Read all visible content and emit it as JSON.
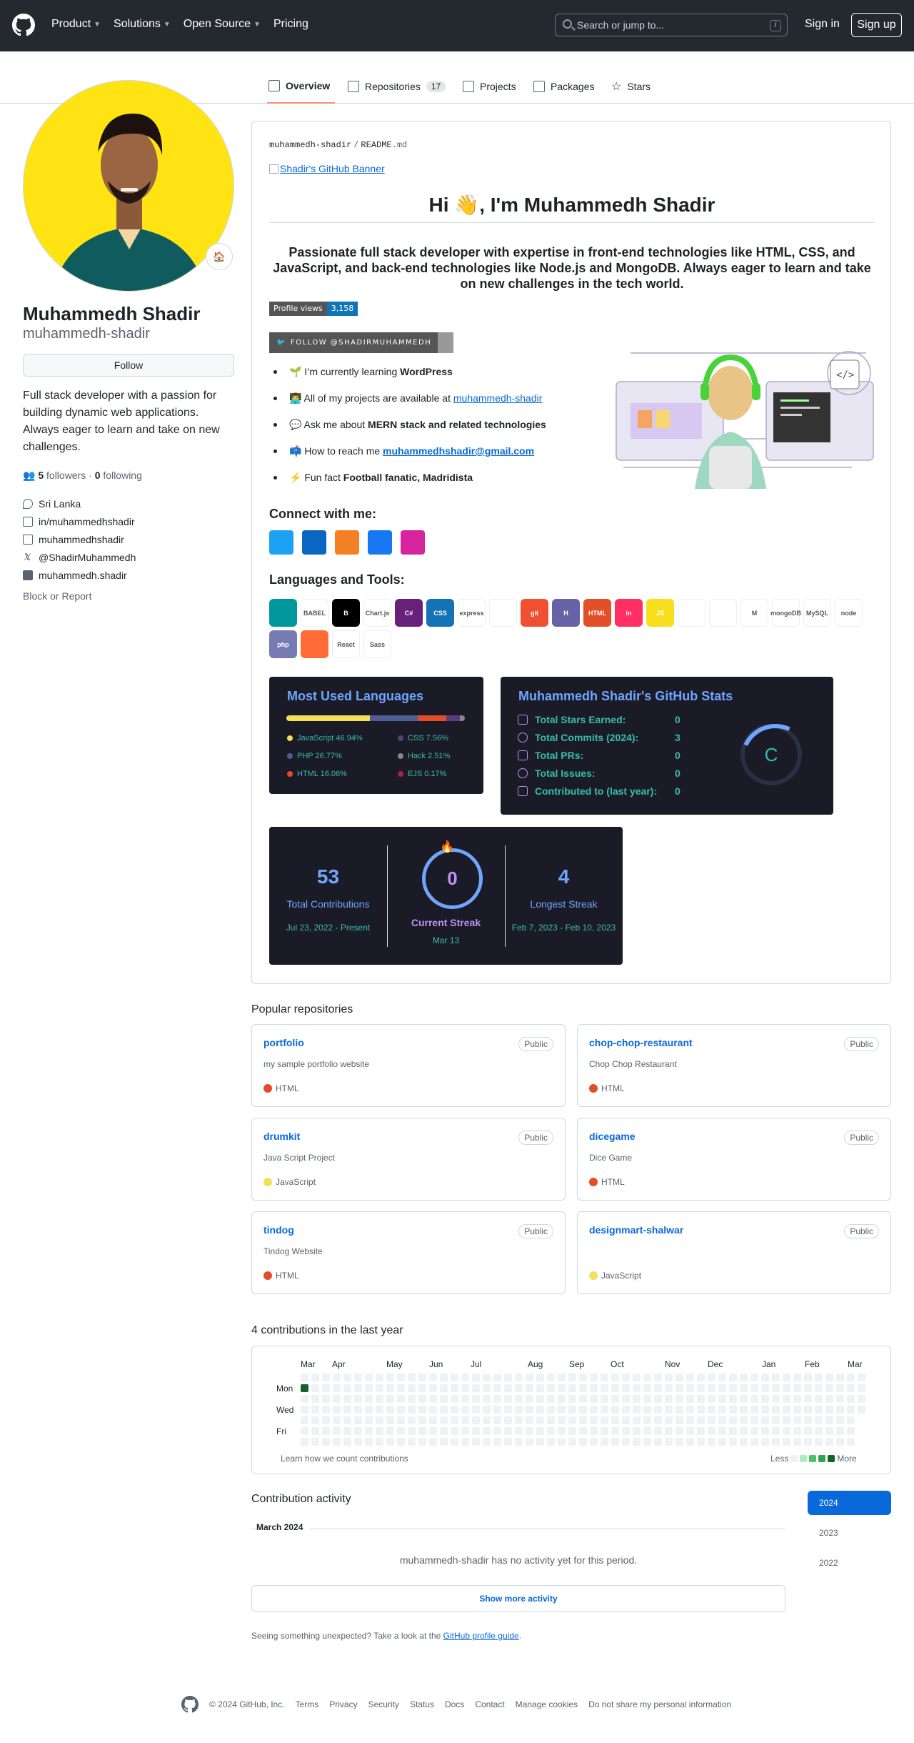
{
  "header": {
    "nav": [
      "Product",
      "Solutions",
      "Open Source",
      "Pricing"
    ],
    "search_placeholder": "Search or jump to...",
    "search_key": "/",
    "signin": "Sign in",
    "signup": "Sign up"
  },
  "tabs": [
    {
      "label": "Overview"
    },
    {
      "label": "Repositories",
      "count": "17"
    },
    {
      "label": "Projects"
    },
    {
      "label": "Packages"
    },
    {
      "label": "Stars"
    }
  ],
  "profile": {
    "name": "Muhammedh Shadir",
    "login": "muhammedh-shadir",
    "follow": "Follow",
    "bio": "Full stack developer with a passion for building dynamic web applications. Always eager to learn and take on new challenges.",
    "followers": "5",
    "followers_label": "followers",
    "following": "0",
    "following_label": "following",
    "sep": "·",
    "location": "Sri Lanka",
    "linkedin": "in/muhammedhshadir",
    "instagram": "muhammedhshadir",
    "x": "@ShadirMuhammedh",
    "facebook": "muhammedh.shadir",
    "block": "Block or Report"
  },
  "readme": {
    "path_user": "muhammedh-shadir",
    "path_sep": "/",
    "path_file": "README",
    "path_ext": ".md",
    "banner_alt": "Shadir's GitHub Banner",
    "hi": "Hi 👋, I'm Muhammedh Shadir",
    "tagline": "Passionate full stack developer with expertise in front-end technologies like HTML, CSS, and JavaScript, and back-end technologies like Node.js and MongoDB. Always eager to learn and take on new challenges in the tech world.",
    "views_label": "Profile views",
    "views_value": "3,158",
    "twitter_follow": "FOLLOW @SHADIRMUHAMMEDH",
    "bullets": [
      {
        "pre": "🌱 I’m currently learning ",
        "bold": "WordPress"
      },
      {
        "pre": "👨‍💻 All of my projects are available at ",
        "link": "muhammedh-shadir"
      },
      {
        "pre": "💬 Ask me about ",
        "bold": "MERN stack and related technologies"
      },
      {
        "pre": "📫 How to reach me ",
        "link": "muhammedhshadir@gmail.com"
      },
      {
        "pre": "⚡ Fun fact ",
        "bold": "Football fanatic, Madridista"
      }
    ],
    "connect": "Connect with me:",
    "tools_title": "Languages and Tools:",
    "tools": [
      {
        "t": "",
        "c": "#00979d"
      },
      {
        "t": "BABEL",
        "c": "#ffffff"
      },
      {
        "t": "B",
        "c": "#000000"
      },
      {
        "t": "Chart.js",
        "c": "#ffffff"
      },
      {
        "t": "C#",
        "c": "#68217a"
      },
      {
        "t": "CSS",
        "c": "#1572b6"
      },
      {
        "t": "express",
        "c": "#ffffff"
      },
      {
        "t": "",
        "c": "#ffffff"
      },
      {
        "t": "git",
        "c": "#f05032"
      },
      {
        "t": "H",
        "c": "#6762a6"
      },
      {
        "t": "HTML",
        "c": "#e34f26"
      },
      {
        "t": "in",
        "c": "#ff2e63"
      },
      {
        "t": "JS",
        "c": "#f7df1e"
      },
      {
        "t": "",
        "c": "#ffffff"
      },
      {
        "t": "",
        "c": "#ffffff"
      },
      {
        "t": "M",
        "c": "#ffffff"
      },
      {
        "t": "mongoDB",
        "c": "#ffffff"
      },
      {
        "t": "MySQL",
        "c": "#ffffff"
      },
      {
        "t": "node",
        "c": "#ffffff"
      },
      {
        "t": "php",
        "c": "#777bb4"
      },
      {
        "t": "",
        "c": "#ff6c37"
      },
      {
        "t": "React",
        "c": "#ffffff"
      },
      {
        "t": "Sass",
        "c": "#ffffff"
      }
    ]
  },
  "langs": {
    "title": "Most Used Languages",
    "items": [
      {
        "name": "JavaScript 46.94%",
        "pct": 46.94,
        "color": "#f1e05a"
      },
      {
        "name": "CSS 7.56%",
        "pct": 7.56,
        "color": "#563d7c"
      },
      {
        "name": "PHP 26.77%",
        "pct": 26.77,
        "color": "#4f5d95"
      },
      {
        "name": "Hack 2.51%",
        "pct": 2.51,
        "color": "#878787"
      },
      {
        "name": "HTML 16.06%",
        "pct": 16.06,
        "color": "#e34c26"
      },
      {
        "name": "EJS 0.17%",
        "pct": 0.17,
        "color": "#a91e50"
      }
    ]
  },
  "stats": {
    "title": "Muhammedh Shadir's GitHub Stats",
    "rows": [
      {
        "label": "Total Stars Earned:",
        "value": "0"
      },
      {
        "label": "Total Commits (2024):",
        "value": "3"
      },
      {
        "label": "Total PRs:",
        "value": "0"
      },
      {
        "label": "Total Issues:",
        "value": "0"
      },
      {
        "label": "Contributed to (last year):",
        "value": "0"
      }
    ],
    "rank": "C"
  },
  "streak": {
    "total": "53",
    "total_label": "Total Contributions",
    "total_range": "Jul 23, 2022 - Present",
    "current": "0",
    "current_label": "Current Streak",
    "current_date": "Mar 13",
    "longest": "4",
    "longest_label": "Longest Streak",
    "longest_range": "Feb 7, 2023 - Feb 10, 2023"
  },
  "popular_title": "Popular repositories",
  "repos": [
    {
      "name": "portfolio",
      "vis": "Public",
      "desc": "my sample portfolio website",
      "lang": "HTML",
      "color": "#e34c26"
    },
    {
      "name": "chop-chop-restaurant",
      "vis": "Public",
      "desc": "Chop Chop Restaurant",
      "lang": "HTML",
      "color": "#e34c26"
    },
    {
      "name": "drumkit",
      "vis": "Public",
      "desc": "Java Script Project",
      "lang": "JavaScript",
      "color": "#f1e05a"
    },
    {
      "name": "dicegame",
      "vis": "Public",
      "desc": "Dice Game",
      "lang": "HTML",
      "color": "#e34c26"
    },
    {
      "name": "tindog",
      "vis": "Public",
      "desc": "Tindog Website",
      "lang": "HTML",
      "color": "#e34c26"
    },
    {
      "name": "designmart-shalwar",
      "vis": "Public",
      "desc": "",
      "lang": "JavaScript",
      "color": "#f1e05a"
    }
  ],
  "contrib": {
    "title": "4 contributions in the last year",
    "months": [
      "Mar",
      "Apr",
      "May",
      "Jun",
      "Jul",
      "Aug",
      "Sep",
      "Oct",
      "Nov",
      "Dec",
      "Jan",
      "Feb",
      "Mar"
    ],
    "days": [
      "Mon",
      "Wed",
      "Fri"
    ],
    "learn": "Learn how we count contributions",
    "less": "Less",
    "more": "More"
  },
  "activity": {
    "title": "Contribution activity",
    "years": [
      "2024",
      "2023",
      "2022"
    ],
    "month": "March 2024",
    "empty": "muhammedh-shadir has no activity yet for this period.",
    "show_more": "Show more activity",
    "unexpected": "Seeing something unexpected? Take a look at the ",
    "guide": "GitHub profile guide",
    "period": "."
  },
  "footer": [
    "© 2024 GitHub, Inc.",
    "Terms",
    "Privacy",
    "Security",
    "Status",
    "Docs",
    "Contact",
    "Manage cookies",
    "Do not share my personal information"
  ]
}
